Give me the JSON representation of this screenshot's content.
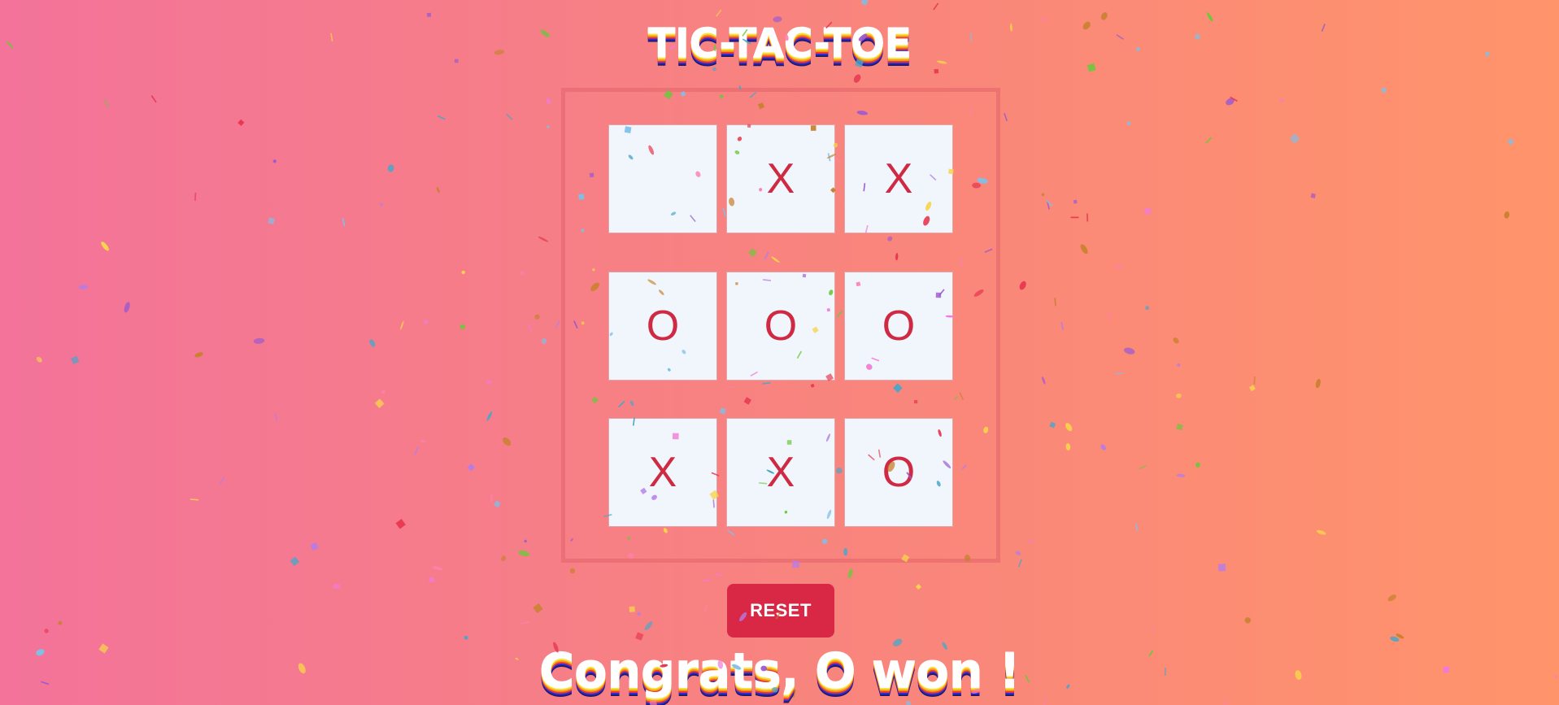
{
  "title": "TIC-TAC-TOE",
  "board": {
    "cells": [
      "",
      "X",
      "X",
      "O",
      "O",
      "O",
      "X",
      "X",
      "O"
    ]
  },
  "reset_label": "RESET",
  "status_message": "Congrats, O won !",
  "colors": {
    "background_start": "#f3739a",
    "background_end": "#ff946b",
    "cell_background": "#f0f6fb",
    "mark_color": "#cf2a44",
    "reset_button": "#d82845"
  },
  "confetti_palette": [
    "#6bc83c",
    "#b57ce8",
    "#e8384f",
    "#f7d44a",
    "#4aa6c8",
    "#f27ad6",
    "#c9812f",
    "#9b59d0",
    "#ff7fa8",
    "#7fc0e8"
  ]
}
